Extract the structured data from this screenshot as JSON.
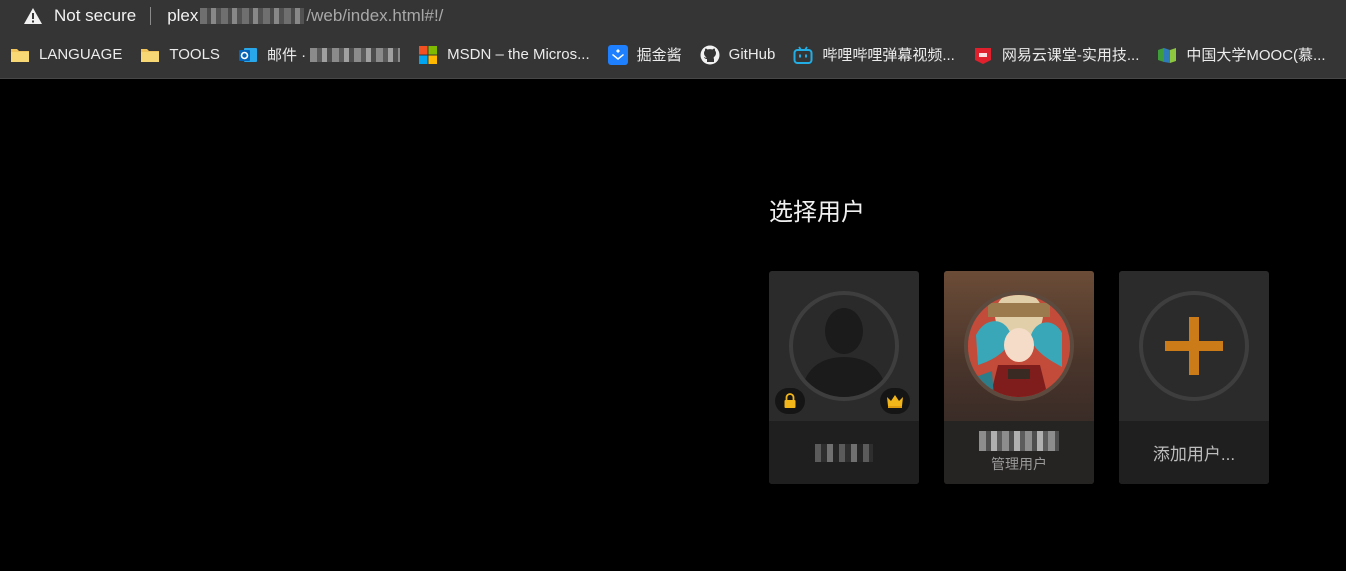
{
  "browser": {
    "security_label": "Not secure",
    "url_host": "plex",
    "url_path": "/web/index.html#!/"
  },
  "bookmarks": [
    {
      "label": "LANGUAGE",
      "icon": "folder-icon"
    },
    {
      "label": "TOOLS",
      "icon": "folder-icon"
    },
    {
      "label": "邮件 ·",
      "icon": "outlook-icon"
    },
    {
      "label": "MSDN – the Micros...",
      "icon": "microsoft-icon"
    },
    {
      "label": "掘金酱",
      "icon": "juejin-icon"
    },
    {
      "label": "GitHub",
      "icon": "github-icon"
    },
    {
      "label": "哔哩哔哩弹幕视频...",
      "icon": "bilibili-icon"
    },
    {
      "label": "网易云课堂-实用技...",
      "icon": "netease-study-icon"
    },
    {
      "label": "中国大学MOOC(慕...",
      "icon": "mooc-icon"
    }
  ],
  "main": {
    "title": "选择用户",
    "users": [
      {
        "role": "",
        "badges": [
          "lock-icon",
          "crown-icon"
        ]
      },
      {
        "role": "管理用户",
        "badges": []
      }
    ],
    "add_user_label": "添加用户..."
  },
  "colors": {
    "accent": "#cc7b19",
    "background": "#000000",
    "toolbar": "#353535"
  }
}
